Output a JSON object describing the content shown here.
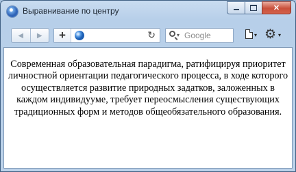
{
  "window": {
    "title": "Выравнивание по центру",
    "caption_buttons": [
      "minimize",
      "maximize",
      "close"
    ]
  },
  "toolbar": {
    "back_icon": "arrow-left-icon",
    "forward_icon": "arrow-right-icon",
    "add_tab_label": "+",
    "address_value": "",
    "reload_glyph": "↻",
    "search_placeholder": "Google"
  },
  "content": {
    "paragraph": "Современная образовательная парадигма, ратифицируя приоритет личностной ориентации педагогического процесса, в ходе которого осуществляется развитие природных задатков, заложенных в каждом индивидууме, требует переосмысления существующих традиционных форм и методов общеобязательного образования."
  },
  "colors": {
    "chrome": "#bcd2ea",
    "frame_border": "#3f5f82",
    "close_button": "#c9503b"
  }
}
